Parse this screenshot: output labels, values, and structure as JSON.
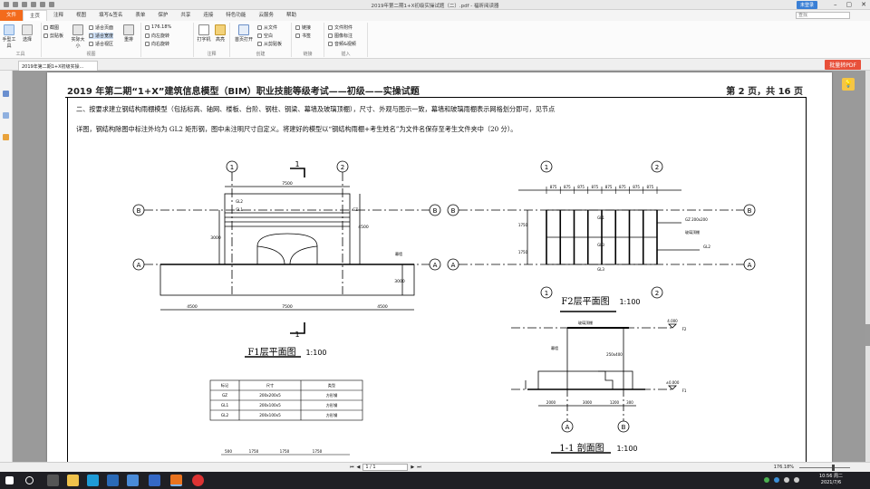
{
  "window": {
    "title": "2019年第二期1+X初级实操试题（二）.pdf - 福昕阅读器",
    "login_label": "未登录",
    "controls": [
      "–",
      "▢",
      "✕"
    ]
  },
  "menu": {
    "tabs": [
      "文件",
      "主页",
      "注释",
      "视图",
      "填写&签名",
      "表单",
      "保护",
      "共享",
      "连接",
      "特色功能",
      "云服务",
      "帮助"
    ],
    "search_placeholder": "查找"
  },
  "ribbon": {
    "groups": [
      {
        "label": "工具",
        "items": [
          "手型工具",
          "选择"
        ]
      },
      {
        "label": "视图",
        "items": [
          "实际大小",
          "适合页面",
          "适合宽度",
          "适合视区",
          "重排",
          "截图",
          "剪贴板"
        ]
      },
      {
        "label": "",
        "items": [
          "176.18%",
          "向左旋转",
          "向右旋转"
        ]
      },
      {
        "label": "注释",
        "items": [
          "打字机",
          "高亮"
        ]
      },
      {
        "label": "创建",
        "items": [
          "首页打开",
          "从文件",
          "空白",
          "从剪贴板"
        ]
      },
      {
        "label": "链接",
        "items": [
          "链接",
          "书签"
        ]
      },
      {
        "label": "插入",
        "items": [
          "文件附件",
          "图像标注",
          "音频&视频"
        ]
      }
    ]
  },
  "document": {
    "tab_label": "2019年第二期1+X初级实操...",
    "convert_button": "批量转PDF"
  },
  "page": {
    "title": "2019 年第二期“1+X”建筑信息模型（BIM）职业技能等级考试——初级——实操试题",
    "page_number": "第 2 页，共 16 页",
    "question_line1": "二、按要求建立钢结构雨棚模型（包括标高、轴网、楼板、台阶、钢柱、钢梁、幕墙及玻璃顶棚），尺寸、外观与图示一致，幕墙和玻璃雨棚表示网格划分即可，见节点",
    "question_line2": "详图，钢结构除图中标注外均为 GL2 矩形钢，图中未注明尺寸自定义。将建好的模型以“钢结构雨棚+考生姓名”为文件名保存至考生文件夹中（20 分）。"
  },
  "drawing": {
    "f1": {
      "caption": "F1层平面图",
      "scale": "1:100",
      "axes": [
        "1",
        "2",
        "A",
        "B"
      ],
      "dims_top": "7500",
      "dims_bottom": [
        "4500",
        "7500",
        "4500"
      ],
      "side_dims": [
        "3000",
        "3000",
        "4500"
      ],
      "section_mark": "1",
      "labels": [
        "GL2",
        "GL1",
        "GZ",
        "幕墙"
      ]
    },
    "f2": {
      "caption": "F2层平面图",
      "scale": "1:100",
      "axes": [
        "1",
        "2",
        "A",
        "B"
      ],
      "dims_top": [
        "875",
        "875",
        "875",
        "875",
        "875",
        "875",
        "875",
        "875"
      ],
      "labels": [
        "GZ 200x200",
        "玻璃顶棚",
        "GL2",
        "GL1",
        "GL3",
        "GL3"
      ],
      "side_dims": [
        "1750",
        "1750"
      ]
    },
    "section": {
      "caption": "1-1 剖面图",
      "scale": "1:100",
      "labels": [
        "玻璃顶棚",
        "幕墙",
        "250x400",
        "4.000",
        "±0.000"
      ],
      "levels": [
        "F2",
        "F1"
      ],
      "dims_bottom": [
        "2000",
        "3000",
        "1200",
        "300"
      ],
      "axes": [
        "A",
        "B"
      ]
    },
    "table": {
      "headers": [
        "标记",
        "尺寸",
        "类型"
      ],
      "rows": [
        [
          "GZ",
          "200x200x5",
          "方形钢"
        ],
        [
          "GL1",
          "200x100x5",
          "方形钢"
        ],
        [
          "GL2",
          "200x100x5",
          "方形钢"
        ]
      ]
    },
    "bottom_dims": [
      "500",
      "1750",
      "1750",
      "1750"
    ]
  },
  "statusbar": {
    "page_value": "1 / 1",
    "zoom": "176.18%"
  },
  "taskbar": {
    "time": "10:56 周二",
    "date": "2021/7/6"
  },
  "colors": {
    "file_tab": "#f36b1c",
    "convert_button": "#e8503a",
    "taskbar": "#1f1f24"
  }
}
